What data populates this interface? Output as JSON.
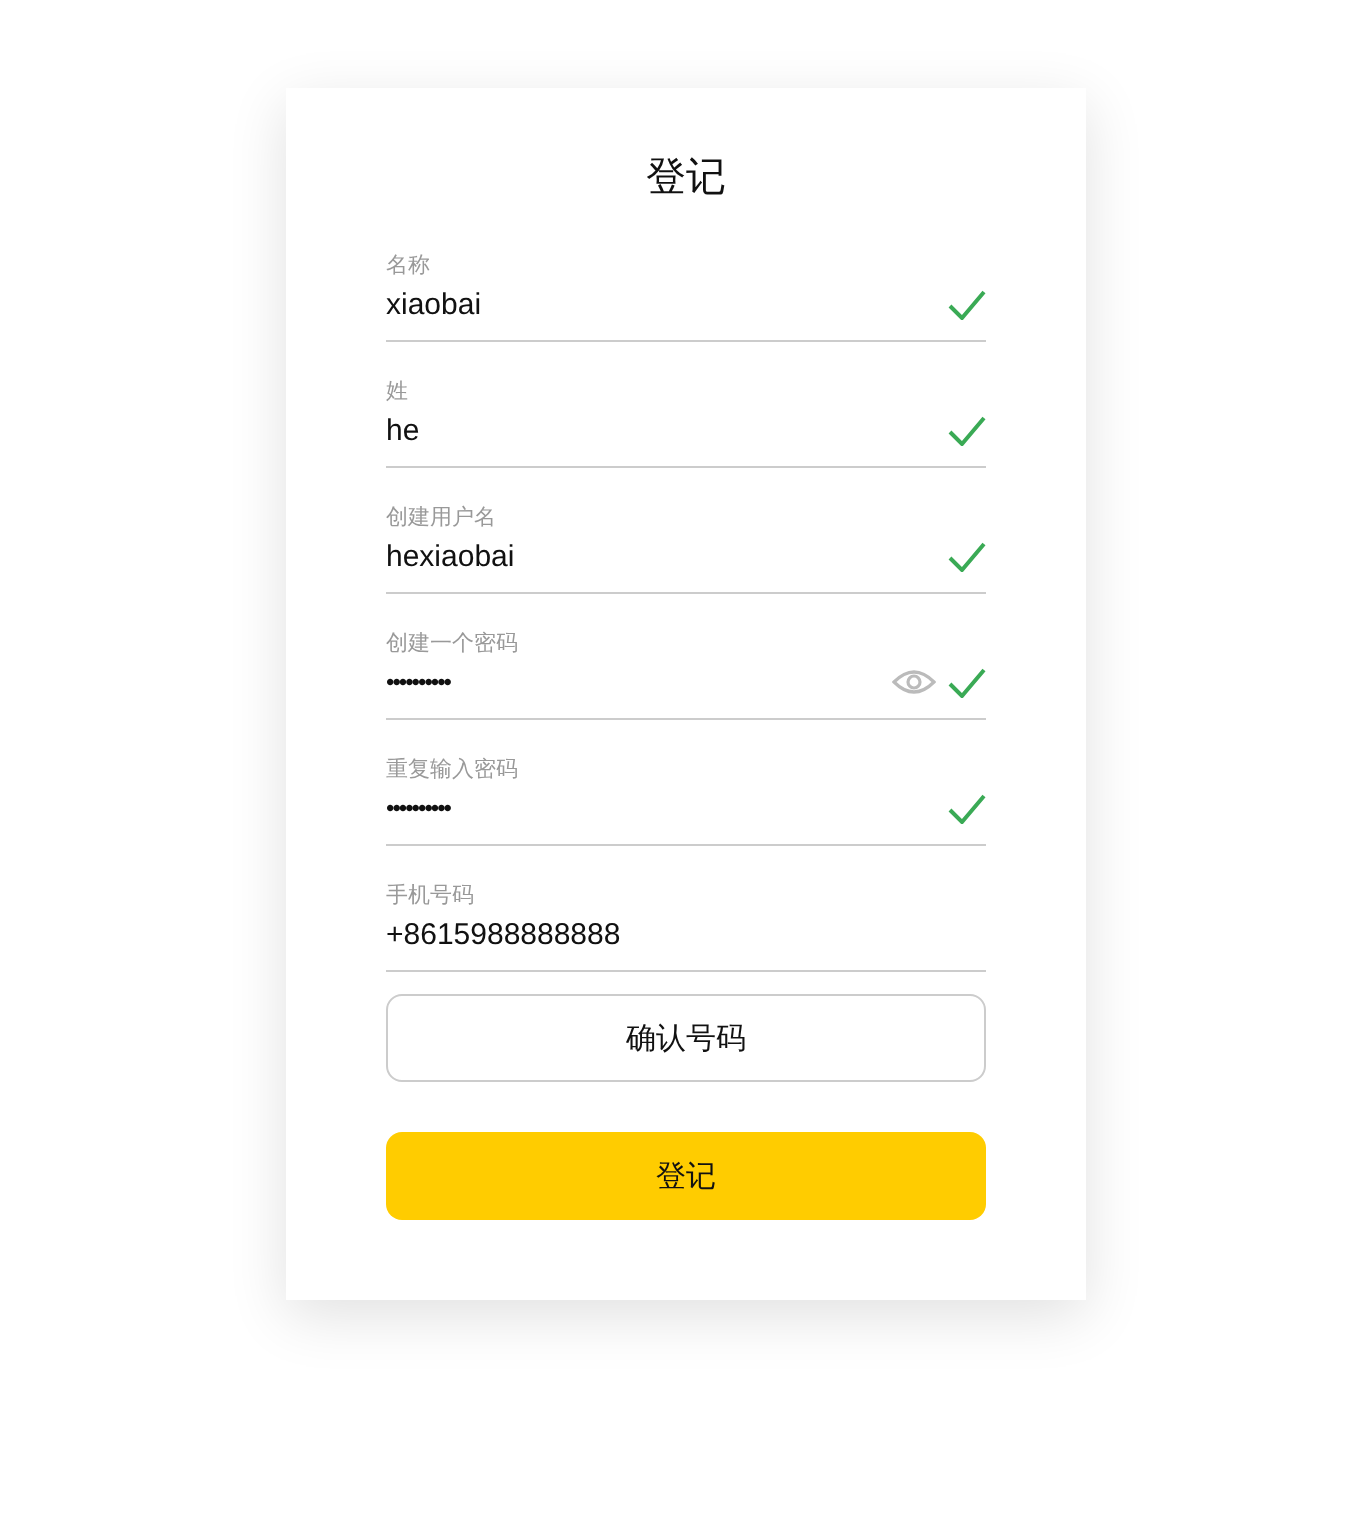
{
  "title": "登记",
  "fields": [
    {
      "label": "名称",
      "value": "xiaobai",
      "kind": "text",
      "valid": true,
      "reveal_toggle": false
    },
    {
      "label": "姓",
      "value": "he",
      "kind": "text",
      "valid": true,
      "reveal_toggle": false
    },
    {
      "label": "创建用户名",
      "value": "hexiaobai",
      "kind": "text",
      "valid": true,
      "reveal_toggle": false
    },
    {
      "label": "创建一个密码",
      "value": "••••••••••",
      "kind": "password",
      "valid": true,
      "reveal_toggle": true
    },
    {
      "label": "重复输入密码",
      "value": "••••••••••",
      "kind": "password",
      "valid": true,
      "reveal_toggle": false
    },
    {
      "label": "手机号码",
      "value": "+8615988888888",
      "kind": "text",
      "valid": false,
      "reveal_toggle": false
    }
  ],
  "confirm_button": "确认号码",
  "submit_button": "登记"
}
